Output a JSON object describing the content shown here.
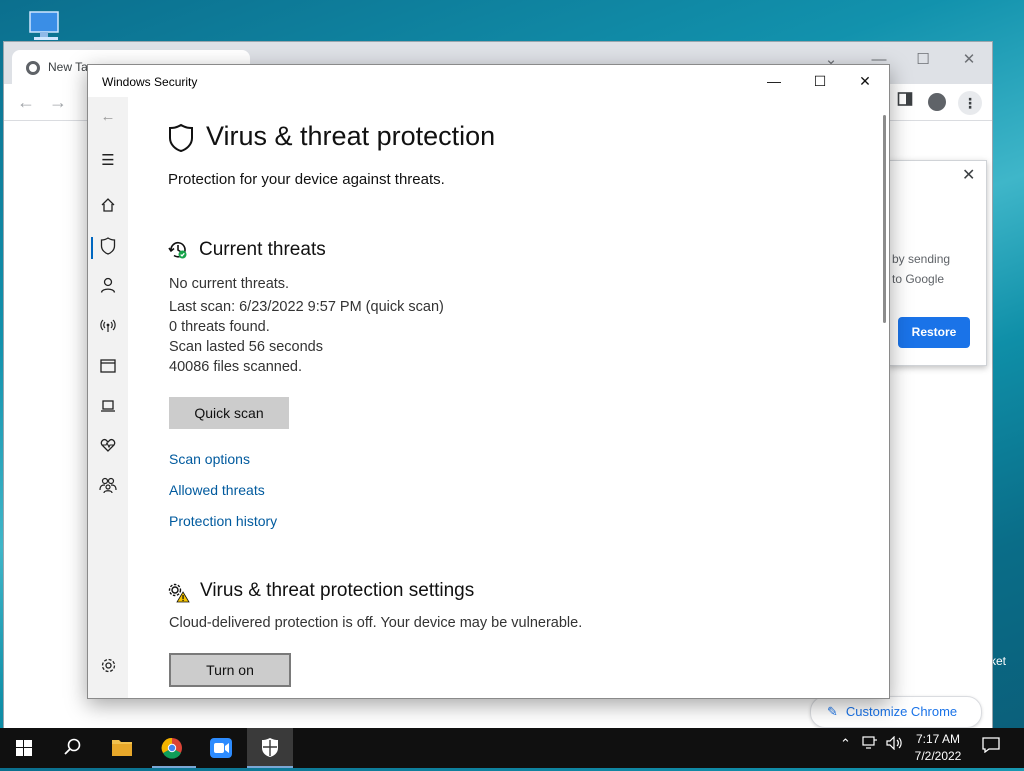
{
  "desktop": {
    "side_text": "ket"
  },
  "chrome": {
    "tab_title": "New Ta",
    "popup_text_1": "by sending",
    "popup_text_2": "to Google",
    "restore_label": "Restore",
    "customize_label": "Customize Chrome"
  },
  "window": {
    "title": "Windows Security"
  },
  "page": {
    "title": "Virus & threat protection",
    "subtitle": "Protection for your device against threats."
  },
  "current_threats": {
    "heading": "Current threats",
    "status": "No current threats.",
    "last_scan": "Last scan: 6/23/2022 9:57 PM (quick scan)",
    "found": "0 threats found.",
    "duration": "Scan lasted 56 seconds",
    "files": "40086 files scanned.",
    "quick_scan_label": "Quick scan",
    "links": [
      "Scan options",
      "Allowed threats",
      "Protection history"
    ]
  },
  "settings": {
    "heading": "Virus & threat protection settings",
    "warning": "Cloud-delivered protection is off. Your device may be vulnerable.",
    "turn_on_label": "Turn on"
  },
  "taskbar": {
    "time": "7:17 AM",
    "date": "7/2/2022"
  },
  "colors": {
    "accent": "#0067c0",
    "link": "#005a9e",
    "chrome_blue": "#1a73e8"
  }
}
